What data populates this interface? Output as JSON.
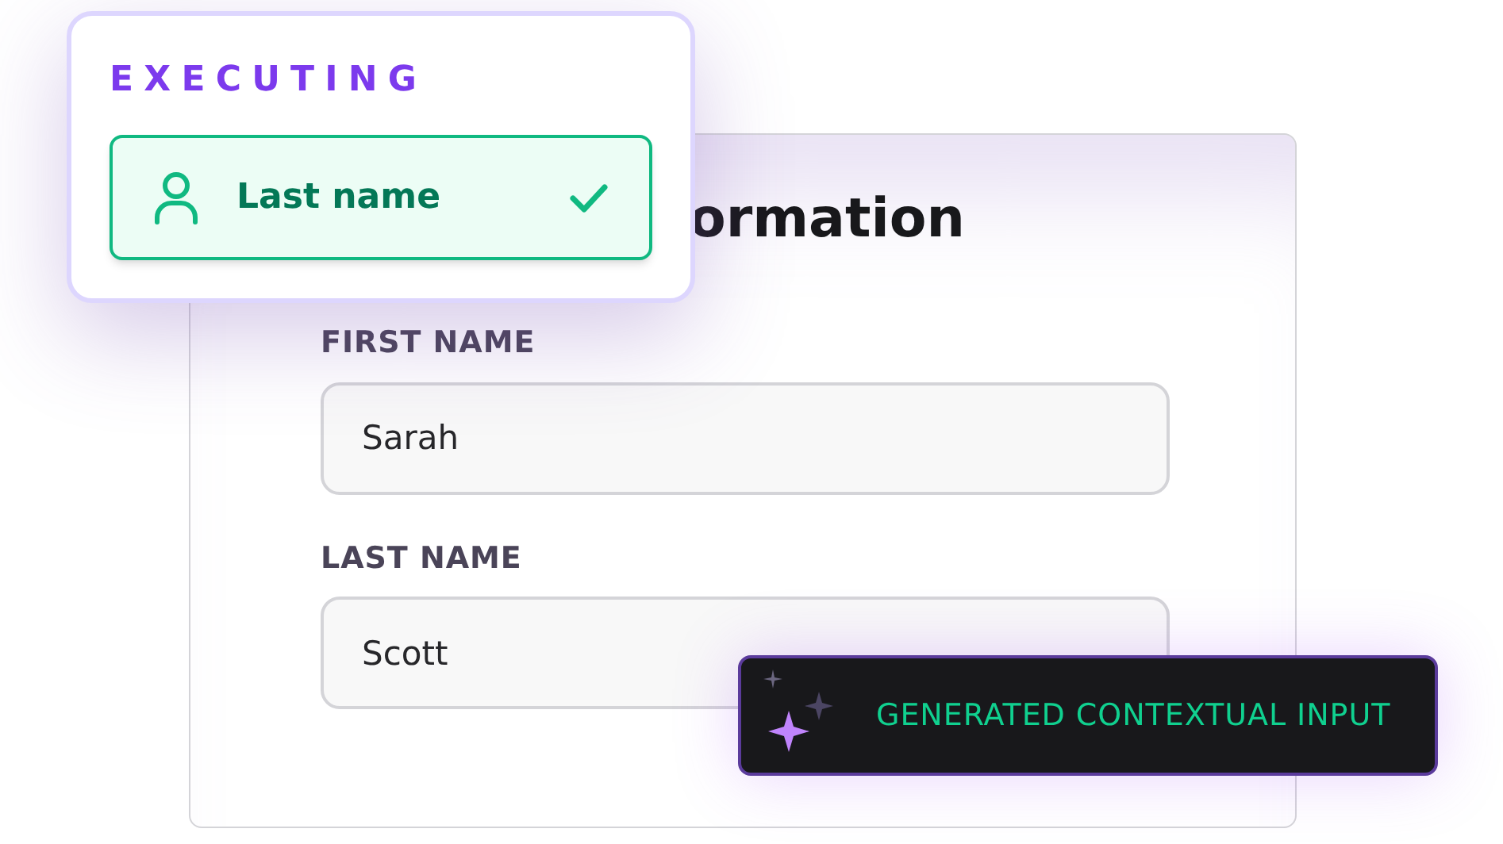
{
  "form": {
    "title": "ormation",
    "fields": [
      {
        "label": "FIRST NAME",
        "value": "Sarah"
      },
      {
        "label": "LAST NAME",
        "value": "Scott"
      }
    ]
  },
  "status_popup": {
    "heading": "EXECUTING",
    "step": {
      "label": "Last name",
      "completed": true
    }
  },
  "toast": {
    "text": "GENERATED CONTEXTUAL INPUT"
  }
}
